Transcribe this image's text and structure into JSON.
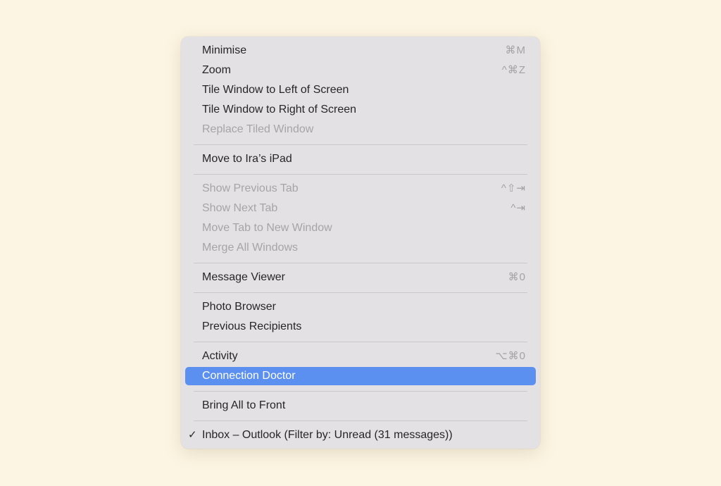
{
  "menu": {
    "groups": [
      [
        {
          "label": "Minimise",
          "shortcut": "⌘M",
          "disabled": false
        },
        {
          "label": "Zoom",
          "shortcut": "^⌘Z",
          "disabled": false
        },
        {
          "label": "Tile Window to Left of Screen",
          "shortcut": "",
          "disabled": false
        },
        {
          "label": "Tile Window to Right of Screen",
          "shortcut": "",
          "disabled": false
        },
        {
          "label": "Replace Tiled Window",
          "shortcut": "",
          "disabled": true
        }
      ],
      [
        {
          "label": "Move to Ira’s iPad",
          "shortcut": "",
          "disabled": false
        }
      ],
      [
        {
          "label": "Show Previous Tab",
          "shortcut": "^⇧⇥",
          "disabled": true
        },
        {
          "label": "Show Next Tab",
          "shortcut": "^⇥",
          "disabled": true
        },
        {
          "label": "Move Tab to New Window",
          "shortcut": "",
          "disabled": true
        },
        {
          "label": "Merge All Windows",
          "shortcut": "",
          "disabled": true
        }
      ],
      [
        {
          "label": "Message Viewer",
          "shortcut": "⌘0",
          "disabled": false
        }
      ],
      [
        {
          "label": "Photo Browser",
          "shortcut": "",
          "disabled": false
        },
        {
          "label": "Previous Recipients",
          "shortcut": "",
          "disabled": false
        }
      ],
      [
        {
          "label": "Activity",
          "shortcut": "⌥⌘0",
          "disabled": false
        },
        {
          "label": "Connection Doctor",
          "shortcut": "",
          "disabled": false,
          "highlighted": true
        }
      ],
      [
        {
          "label": "Bring All to Front",
          "shortcut": "",
          "disabled": false
        }
      ],
      [
        {
          "label": "Inbox – Outlook (Filter by: Unread (31 messages))",
          "shortcut": "",
          "disabled": false,
          "checked": true,
          "check_icon": "checkmark-icon"
        }
      ]
    ],
    "colors": {
      "highlight": "#5b8ff0",
      "background": "#e3e1e4",
      "page": "#fcf5e3"
    }
  }
}
